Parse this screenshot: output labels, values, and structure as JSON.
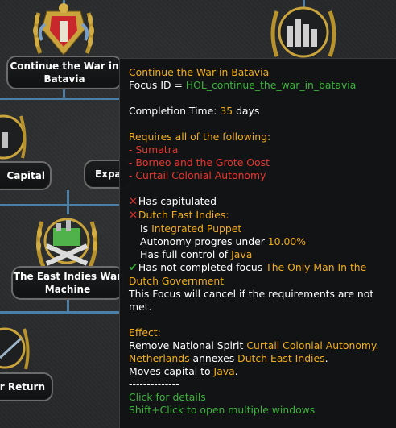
{
  "focus_tree": {
    "nodes": [
      {
        "label": "Continue the War in Batavia"
      },
      {
        "label": "Capital"
      },
      {
        "label": "Expa"
      },
      {
        "label": "The East Indies War Machine"
      },
      {
        "label": "ur Return"
      }
    ]
  },
  "tooltip": {
    "title": "Continue the War in Batavia",
    "focus_id_label": "Focus ID = ",
    "focus_id": "HOL_continue_the_war_in_batavia",
    "completion_label": "Completion Time: ",
    "completion_value": "35",
    "completion_unit": " days",
    "requires_header": "Requires all of the following:",
    "requires": [
      "- Sumatra",
      "- Borneo and the Grote Oost",
      "- Curtail Colonial Autonomy"
    ],
    "cond1": "Has capitulated",
    "cond2": "Dutch East Indies:",
    "cond2a_prefix": "Is ",
    "cond2a_value": "Integrated Puppet",
    "cond2b_prefix": "Autonomy progres under ",
    "cond2b_value": "10.00%",
    "cond2c_prefix": "Has full control of ",
    "cond2c_value": "Java",
    "cond3_prefix": "Has not completed focus ",
    "cond3_value_1": "The Only Man In the",
    "cond3_value_2": "Dutch Government",
    "cancel_1": "This Focus will cancel if the requirements are not",
    "cancel_2": "met.",
    "effect_header": "Effect:",
    "effect1_prefix": "Remove National Spirit ",
    "effect1_value": "Curtail Colonial Autonomy.",
    "effect2_a": "Netherlands",
    "effect2_b": " annexes ",
    "effect2_c": "Dutch East Indies",
    "effect2_d": ".",
    "effect3_prefix": "Moves capital to ",
    "effect3_value": "Java",
    "effect3_suffix": ".",
    "separator": "--------------",
    "hint1": "Click for details",
    "hint2": "Shift+Click to open multiple windows"
  },
  "colors": {
    "header": "#f0ad1c",
    "id": "#3cb33c",
    "requirement": "#e5382f",
    "connector": "#4c7fa8"
  }
}
